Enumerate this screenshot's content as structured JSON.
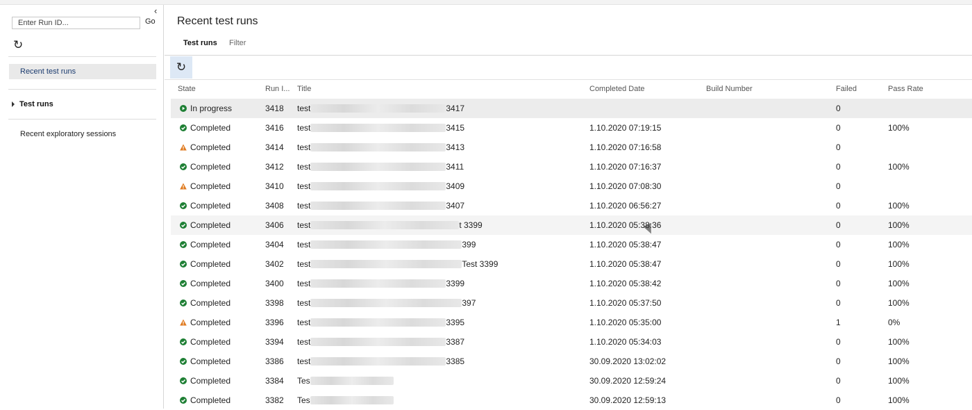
{
  "sidebar": {
    "runid_placeholder": "Enter Run ID...",
    "go_label": "Go",
    "nav": {
      "recent_test_runs": "Recent test runs",
      "test_runs": "Test runs",
      "recent_exploratory": "Recent exploratory sessions"
    }
  },
  "main": {
    "title": "Recent test runs",
    "tabs": {
      "test_runs": "Test runs",
      "filter": "Filter"
    }
  },
  "colors": {
    "pass": "#1e7f34",
    "warn": "#e07a1f",
    "progress": "#1e7f34",
    "selected_nav": "#e9e9e9",
    "refresh_bg": "#dde8f5"
  },
  "grid": {
    "columns": [
      "State",
      "Run I...",
      "Title",
      "Completed Date",
      "Build Number",
      "Failed",
      "Pass Rate"
    ],
    "rows": [
      {
        "icon": "play-icon",
        "state": "In progress",
        "run": "3418",
        "title": "test",
        "title_suffix": "3417",
        "date": "",
        "failed": "0",
        "pass": ""
      },
      {
        "icon": "check-circle-icon",
        "state": "Completed",
        "run": "3416",
        "title": "test",
        "title_suffix": "3415",
        "date": "1.10.2020 07:19:15",
        "failed": "0",
        "pass": "100%"
      },
      {
        "icon": "warning-icon",
        "state": "Completed",
        "run": "3414",
        "title": "test",
        "title_suffix": "3413",
        "date": "1.10.2020 07:16:58",
        "failed": "0",
        "pass": ""
      },
      {
        "icon": "check-circle-icon",
        "state": "Completed",
        "run": "3412",
        "title": "test",
        "title_suffix": "3411",
        "date": "1.10.2020 07:16:37",
        "failed": "0",
        "pass": "100%"
      },
      {
        "icon": "warning-icon",
        "state": "Completed",
        "run": "3410",
        "title": "test",
        "title_suffix": "3409",
        "date": "1.10.2020 07:08:30",
        "failed": "0",
        "pass": ""
      },
      {
        "icon": "check-circle-icon",
        "state": "Completed",
        "run": "3408",
        "title": "test",
        "title_suffix": "3407",
        "date": "1.10.2020 06:56:27",
        "failed": "0",
        "pass": "100%"
      },
      {
        "icon": "check-circle-icon",
        "state": "Completed",
        "run": "3406",
        "title": "test",
        "title_suffix": "t 3399",
        "date": "1.10.2020 05:38:36",
        "failed": "0",
        "pass": "100%"
      },
      {
        "icon": "check-circle-icon",
        "state": "Completed",
        "run": "3404",
        "title": "test",
        "title_suffix": "399",
        "date": "1.10.2020 05:38:47",
        "failed": "0",
        "pass": "100%"
      },
      {
        "icon": "check-circle-icon",
        "state": "Completed",
        "run": "3402",
        "title": "test",
        "title_suffix": "Test 3399",
        "date": "1.10.2020 05:38:47",
        "failed": "0",
        "pass": "100%"
      },
      {
        "icon": "check-circle-icon",
        "state": "Completed",
        "run": "3400",
        "title": "test",
        "title_suffix": "3399",
        "date": "1.10.2020 05:38:42",
        "failed": "0",
        "pass": "100%"
      },
      {
        "icon": "check-circle-icon",
        "state": "Completed",
        "run": "3398",
        "title": "test",
        "title_suffix": "397",
        "date": "1.10.2020 05:37:50",
        "failed": "0",
        "pass": "100%"
      },
      {
        "icon": "warning-icon",
        "state": "Completed",
        "run": "3396",
        "title": "test",
        "title_suffix": "3395",
        "date": "1.10.2020 05:35:00",
        "failed": "1",
        "pass": "0%"
      },
      {
        "icon": "check-circle-icon",
        "state": "Completed",
        "run": "3394",
        "title": "test",
        "title_suffix": "3387",
        "date": "1.10.2020 05:34:03",
        "failed": "0",
        "pass": "100%"
      },
      {
        "icon": "check-circle-icon",
        "state": "Completed",
        "run": "3386",
        "title": "test",
        "title_suffix": "3385",
        "date": "30.09.2020 13:02:02",
        "failed": "0",
        "pass": "100%"
      },
      {
        "icon": "check-circle-icon",
        "state": "Completed",
        "run": "3384",
        "title": "Tes",
        "title_suffix": "",
        "date": "30.09.2020 12:59:24",
        "failed": "0",
        "pass": "100%"
      },
      {
        "icon": "check-circle-icon",
        "state": "Completed",
        "run": "3382",
        "title": "Tes",
        "title_suffix": "",
        "date": "30.09.2020 12:59:13",
        "failed": "0",
        "pass": "100%"
      }
    ]
  }
}
